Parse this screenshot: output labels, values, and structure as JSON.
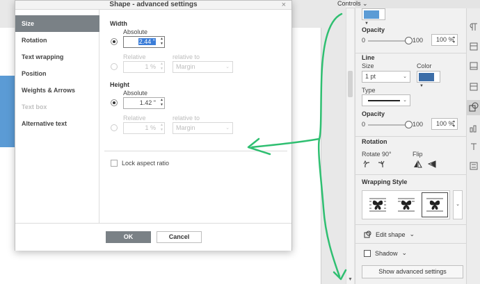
{
  "header": {
    "controls_label": "Controls",
    "controls_chevron": "⌄"
  },
  "dialog": {
    "title": "Shape - advanced settings",
    "close_icon": "×",
    "sidebar": [
      {
        "label": "Size",
        "active": true,
        "disabled": false
      },
      {
        "label": "Rotation",
        "active": false,
        "disabled": false
      },
      {
        "label": "Text wrapping",
        "active": false,
        "disabled": false
      },
      {
        "label": "Position",
        "active": false,
        "disabled": false
      },
      {
        "label": "Weights & Arrows",
        "active": false,
        "disabled": false
      },
      {
        "label": "Text box",
        "active": false,
        "disabled": true
      },
      {
        "label": "Alternative text",
        "active": false,
        "disabled": false
      }
    ],
    "width": {
      "title": "Width",
      "absolute_label": "Absolute",
      "absolute_value": "2.44 \"",
      "relative_label": "Relative",
      "relative_value": "1 %",
      "relative_to_label": "relative to",
      "relative_to_value": "Margin"
    },
    "height": {
      "title": "Height",
      "absolute_label": "Absolute",
      "absolute_value": "1.42 \"",
      "relative_label": "Relative",
      "relative_value": "1 %",
      "relative_to_label": "relative to",
      "relative_to_value": "Margin"
    },
    "lock_aspect_label": "Lock aspect ratio",
    "ok_label": "OK",
    "cancel_label": "Cancel"
  },
  "panel": {
    "fill_color": "#5b9bd5",
    "opacity_label": "Opacity",
    "opacity_min": "0",
    "opacity_max": "100",
    "opacity_value": "100 %",
    "opacity_fraction": 1.0,
    "line_title": "Line",
    "size_label": "Size",
    "size_value": "1 pt",
    "color_label": "Color",
    "line_color": "#3d6ea8",
    "type_label": "Type",
    "line_opacity_label": "Opacity",
    "line_opacity_min": "0",
    "line_opacity_max": "100",
    "line_opacity_value": "100 %",
    "rotation_title": "Rotation",
    "rotate_label": "Rotate 90°",
    "flip_label": "Flip",
    "wrapping_title": "Wrapping Style",
    "edit_shape_label": "Edit shape",
    "shadow_label": "Shadow",
    "advanced_label": "Show advanced settings"
  },
  "colors": {
    "annotation": "#2fbf71",
    "accent_gray": "#7a8186",
    "selection": "#3b7dd8"
  }
}
